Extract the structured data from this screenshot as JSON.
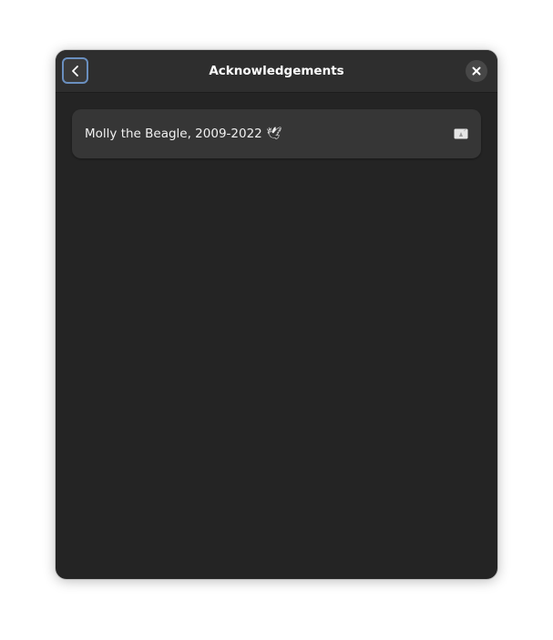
{
  "dialog": {
    "title": "Acknowledgements",
    "back_icon": "chevron-left-icon",
    "close_icon": "close-icon"
  },
  "list": {
    "items": [
      {
        "label": "Molly the Beagle, 2009-2022 🕊",
        "icon": "external-link-icon"
      }
    ]
  },
  "colors": {
    "window_bg": "#242424",
    "header_bg": "#2e2e2e",
    "row_bg": "#363636",
    "focus_ring": "#6a8fbf",
    "text": "#ffffff"
  }
}
